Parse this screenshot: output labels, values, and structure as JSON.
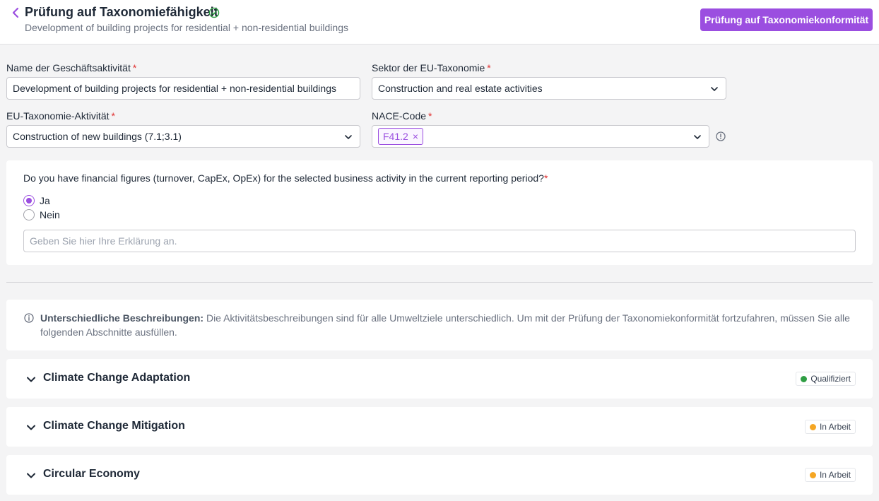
{
  "header": {
    "title": "Prüfung auf Taxonomiefähigkeit",
    "subtitle": "Development of building projects for residential + non-residential buildings",
    "primary_button": "Prüfung auf Taxonomiekonformität"
  },
  "form": {
    "activity_name": {
      "label": "Name der Geschäftsaktivität",
      "required": "*",
      "value": "Development of building projects for residential + non-residential buildings"
    },
    "sector": {
      "label": "Sektor der EU-Taxonomie",
      "required": "*",
      "value": "Construction and real estate activities"
    },
    "eu_activity": {
      "label": "EU-Taxonomie-Aktivität",
      "required": "*",
      "value": "Construction of new buildings (7.1;3.1)"
    },
    "nace": {
      "label": "NACE-Code",
      "required": "*",
      "tag": "F41.2",
      "remove": "×"
    }
  },
  "financials": {
    "question": "Do you have financial figures (turnover, CapEx, OpEx) for the selected business activity in the current reporting period?",
    "required": "*",
    "option_yes": "Ja",
    "option_no": "Nein",
    "selected": "Ja",
    "explanation_placeholder": "Geben Sie hier Ihre Erklärung an."
  },
  "notice": {
    "title": "Unterschiedliche Beschreibungen:",
    "text": " Die Aktivitätsbeschreibungen sind für alle Umweltziele unterschiedlich. Um mit der Prüfung der Taxonomiekonformität fortzufahren, müssen Sie alle folgenden Abschnitte ausfüllen."
  },
  "sections": [
    {
      "title": "Climate Change Adaptation",
      "status": "Qualifiziert",
      "status_color": "#2f9e44"
    },
    {
      "title": "Climate Change Mitigation",
      "status": "In Arbeit",
      "status_color": "#f5a623"
    },
    {
      "title": "Circular Economy",
      "status": "In Arbeit",
      "status_color": "#f5a623"
    }
  ],
  "colors": {
    "accent": "#9b4ee0",
    "required": "#e03131"
  }
}
